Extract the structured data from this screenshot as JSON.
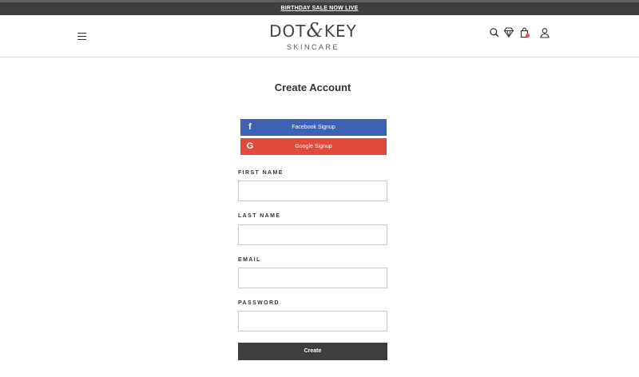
{
  "announcement": {
    "text": "BIRTHDAY SALE NOW LIVE"
  },
  "header": {
    "logo_main_left": "DOT",
    "logo_amp": "&",
    "logo_main_right": "KEY",
    "logo_sub": "SKINCARE",
    "icons": [
      "menu-icon",
      "search-icon",
      "diamond-icon",
      "shopping-bag-icon",
      "user-icon"
    ]
  },
  "main": {
    "title": "Create Account",
    "social": {
      "facebook_label": "Facebook Signup",
      "facebook_icon": "f",
      "google_label": "Google Signup",
      "google_icon": "G"
    },
    "form": {
      "first_name_label": "FIRST NAME",
      "first_name_value": "",
      "last_name_label": "LAST NAME",
      "last_name_value": "",
      "email_label": "EMAIL",
      "email_value": "",
      "password_label": "PASSWORD",
      "password_value": "",
      "submit_label": "Create"
    }
  },
  "colors": {
    "facebook": "#3d62b5",
    "google": "#e1493a",
    "dark": "#3e3e3e",
    "cart_badge": "#e05a4a"
  }
}
